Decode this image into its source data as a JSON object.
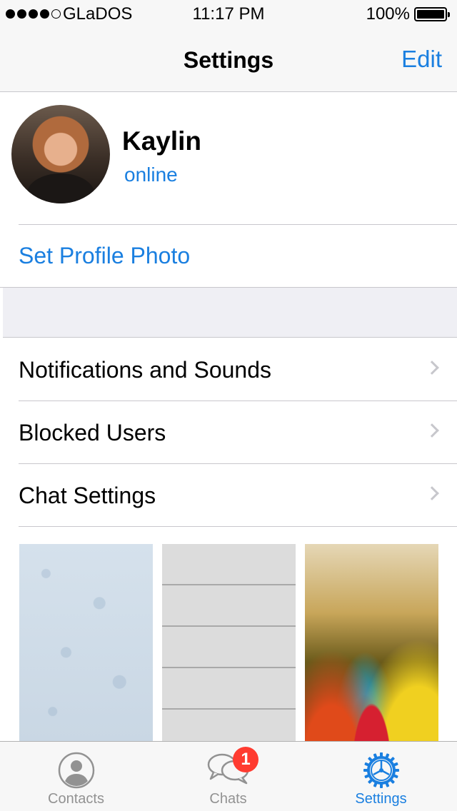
{
  "status_bar": {
    "carrier": "GLaDOS",
    "time": "11:17 PM",
    "battery": "100%",
    "signal_bars": 4
  },
  "nav": {
    "title": "Settings",
    "edit_label": "Edit"
  },
  "profile": {
    "name": "Kaylin",
    "status": "online",
    "set_photo_label": "Set Profile Photo"
  },
  "menu": [
    {
      "label": "Notifications and Sounds"
    },
    {
      "label": "Blocked Users"
    },
    {
      "label": "Chat Settings"
    }
  ],
  "wallpapers": [
    "doodle-pattern",
    "white-wood-planks",
    "colorful-umbrella"
  ],
  "tabs": [
    {
      "label": "Contacts",
      "icon": "person-icon",
      "active": false
    },
    {
      "label": "Chats",
      "icon": "chat-bubbles-icon",
      "active": false,
      "badge": "1"
    },
    {
      "label": "Settings",
      "icon": "gear-icon",
      "active": true
    }
  ],
  "colors": {
    "accent": "#1a7fe0",
    "badge": "#ff3b30",
    "separator": "#c8c7cc",
    "background_group": "#efeff4"
  }
}
